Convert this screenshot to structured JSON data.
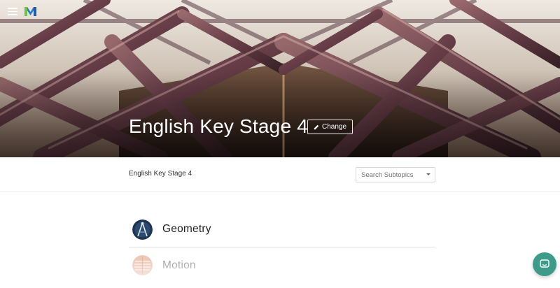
{
  "app": {
    "hero_title": "English Key Stage 4",
    "change_label": "Change"
  },
  "subheader": {
    "breadcrumb": "English Key Stage 4",
    "search_placeholder": "Search Subtopics"
  },
  "topics": [
    {
      "label": "Geometry",
      "icon": "compass-icon"
    },
    {
      "label": "Motion",
      "icon": "motion-icon"
    }
  ],
  "colors": {
    "accent": "#3f9b89",
    "hero_beam": "#7a4e57",
    "logo_green": "#6cc24a",
    "logo_blue": "#2b79c9"
  },
  "icons": {
    "menu": "hamburger-menu-icon",
    "logo": "logo-icon",
    "edit": "pencil-icon",
    "dropdown": "chevron-down-icon",
    "chat": "chat-icon"
  }
}
